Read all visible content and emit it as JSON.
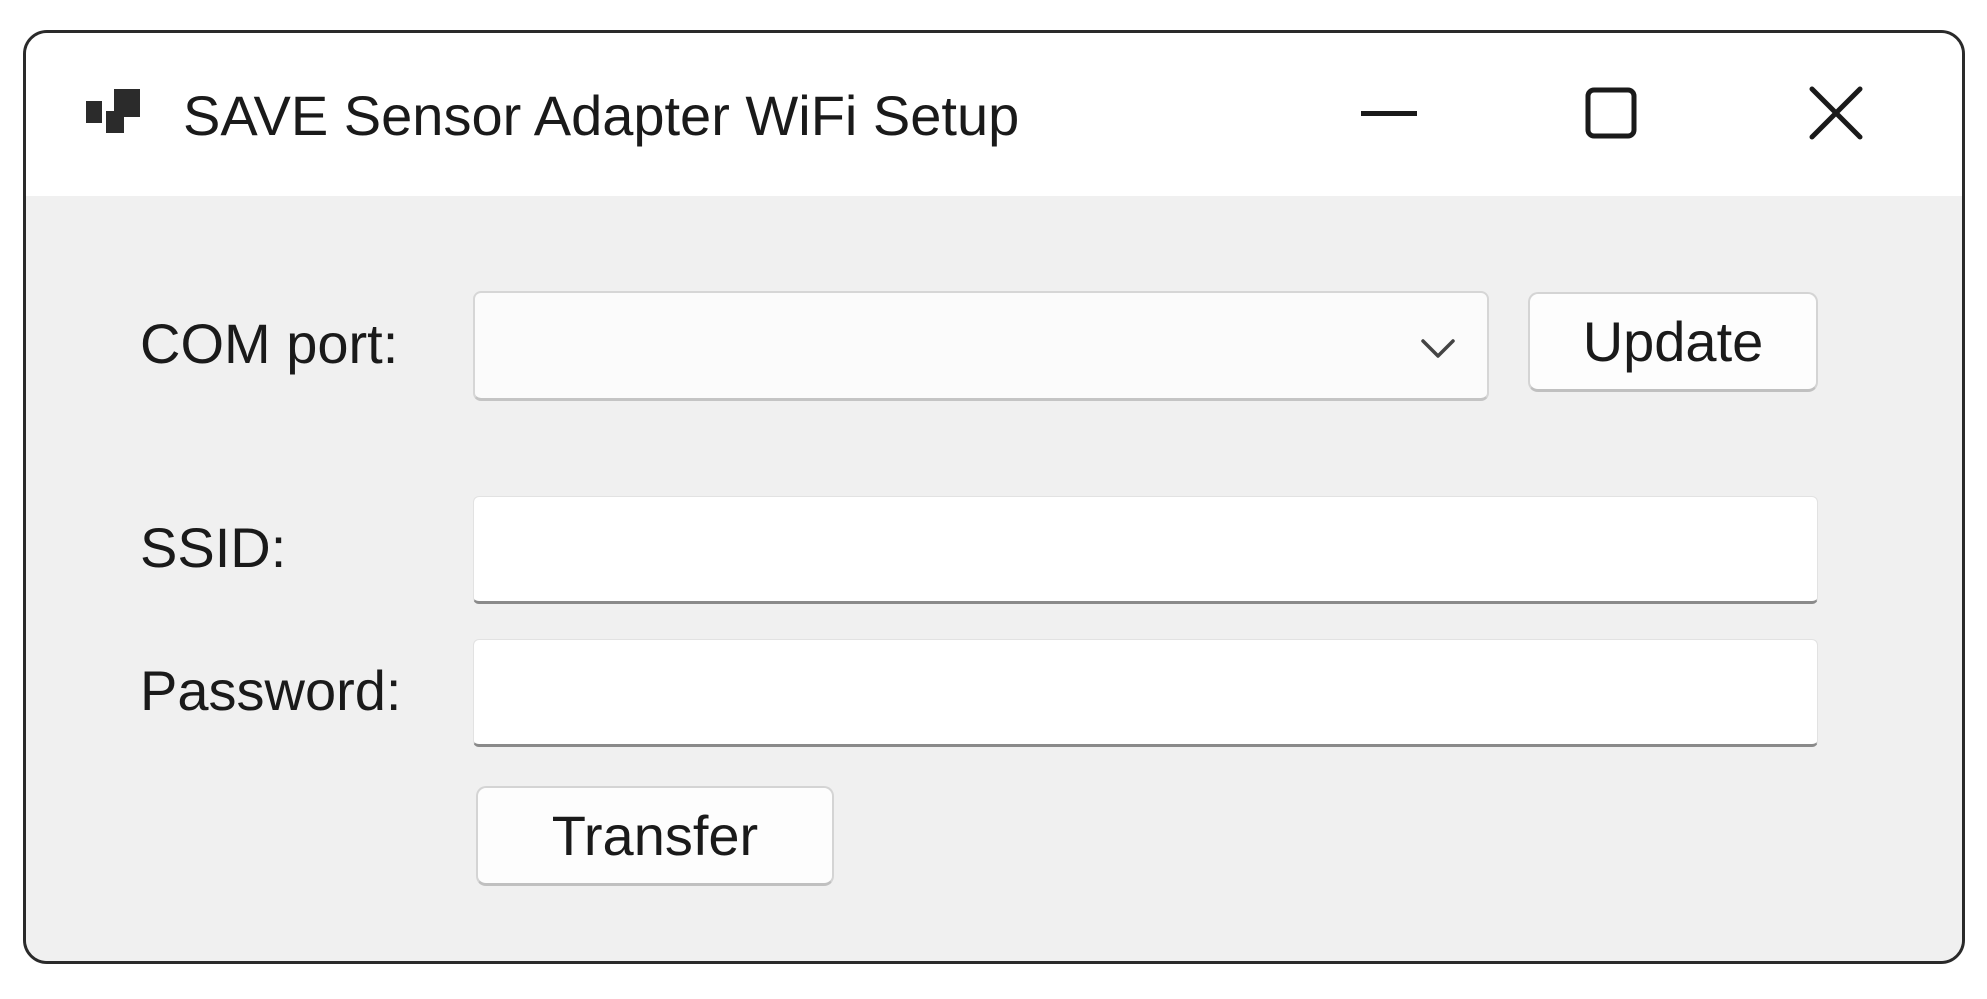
{
  "window": {
    "title": "SAVE Sensor Adapter WiFi Setup",
    "icons": {
      "app": "app-icon",
      "minimize": "minimize-icon",
      "maximize": "maximize-icon",
      "close": "close-icon"
    }
  },
  "form": {
    "com_port": {
      "label": "COM port:",
      "selected_value": "",
      "update_label": "Update"
    },
    "ssid": {
      "label": "SSID:",
      "value": ""
    },
    "password": {
      "label": "Password:",
      "value": ""
    },
    "transfer_label": "Transfer"
  },
  "colors": {
    "titlebar": "#ffffff",
    "client_background": "#f0f0f0",
    "text": "#1a1a1a"
  }
}
